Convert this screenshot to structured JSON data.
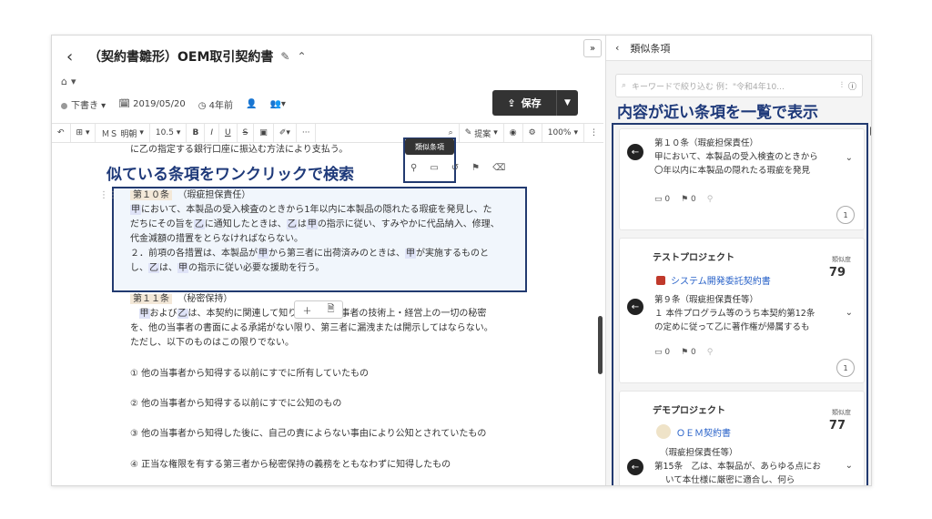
{
  "header": {
    "title": "（契約書雛形）OEM取引契約書",
    "status": "下書き",
    "date": "2019/05/20",
    "relative_time": "4年前",
    "save_label": "保存",
    "expand_label": "»"
  },
  "toolbar": {
    "font": "ＭＳ 明朝",
    "size": "10.5",
    "bold": "B",
    "italic": "I",
    "underline": "U",
    "strike": "S",
    "suggest_label": "提案",
    "zoom": "100%"
  },
  "tooltip": {
    "label": "類似条項"
  },
  "annotations": {
    "left": "似ている条項をワンクリックで検索",
    "right": "内容が近い条項を一覧で表示"
  },
  "document": {
    "line_top": "に乙の指定する銀行口座に振込む方法により支払う。",
    "art10_head": "第１０条",
    "art10_title": "（瑕疵担保責任）",
    "art10_l1a": "において、本製品の受入検査のときから1年以内に本製品の隠れたる瑕疵を発見し、た",
    "art10_l2a": "だちにその旨を",
    "art10_l2b": "に通知したときは、",
    "art10_l2c": "は",
    "art10_l2d": "の指示に従い、すみやかに代品納入、修理、",
    "art10_l3": "代金減額の措置をとらなければならない。",
    "art10_l4a": "２．前項の各措置は、本製品が",
    "art10_l4b": "から第三者に出荷済みのときは、",
    "art10_l4c": "が実施するものと",
    "art10_l5a": "し、",
    "art10_l5b": "は、",
    "art10_l5c": "の指示に従い必要な援助を行う。",
    "party_a": "甲",
    "party_b": "乙",
    "art11_head": "第１１条",
    "art11_title": "（秘密保持）",
    "art11_l1a": "および",
    "art11_l1b": "は、本契約に関連して知り",
    "art11_l1c": "当事者の技術上・経営上の一切の秘密",
    "art11_l2": "を、他の当事者の書面による承諾がない限り、第三者に漏洩または開示してはならない。",
    "art11_l3": "ただし、以下のものはこの限りでない。",
    "item1": "① 他の当事者から知得する以前にすでに所有していたもの",
    "item2": "② 他の当事者から知得する以前にすでに公知のもの",
    "item3": "③ 他の当事者から知得した後に、自己の責によらない事由により公知とされていたもの",
    "item4": "④ 正当な権限を有する第三者から秘密保持の義務をともなわずに知得したもの"
  },
  "panel": {
    "title": "類似条項",
    "search_placeholder": "キーワードで絞り込む 例：\"令和4年10...",
    "cards": [
      {
        "line1": "第１０条（瑕疵担保責任）",
        "line2": "甲において、本製品の受入検査のときから",
        "line3": "〇年以内に本製品の隠れたる瑕疵を発見",
        "comments": "0",
        "bookmarks": "0",
        "page": "1"
      },
      {
        "project": "テストプロジェクト",
        "similarity_label": "類似度",
        "similarity": "79",
        "contract": "システム開発委託契約書",
        "line1": "第９条（瑕疵担保責任等）",
        "line2": "１ 本件プログラム等のうち本契約第12条",
        "line3": "の定めに従って乙に著作権が帰属するも",
        "comments": "0",
        "bookmarks": "0",
        "page": "1"
      },
      {
        "project": "デモプロジェクト",
        "similarity_label": "類似度",
        "similarity": "77",
        "contract": "ＯＥＭ契約書",
        "line1": "（瑕疵担保責任等）",
        "line2": "第15条　乙は、本製品が、あらゆる点にお",
        "line3": "いて本仕様に厳密に適合し、何ら"
      }
    ]
  }
}
